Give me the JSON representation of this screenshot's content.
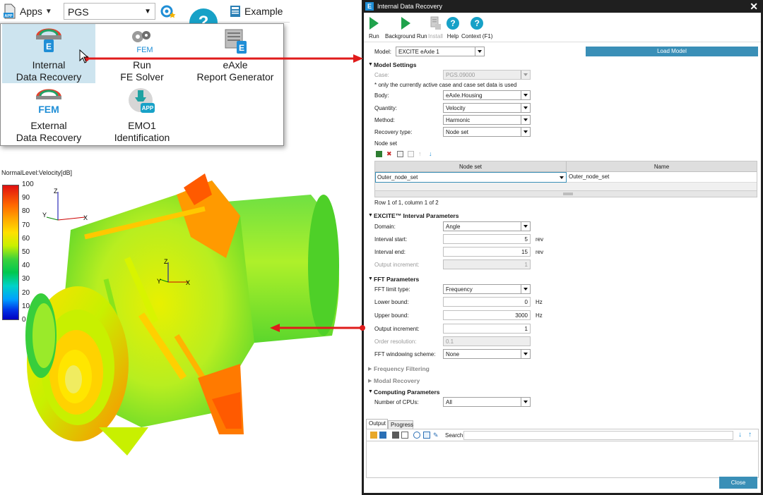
{
  "toolbar": {
    "apps_label": "Apps",
    "project_select": "PGS",
    "example_label": "Example"
  },
  "apps_menu": [
    {
      "line1": "Internal",
      "line2": "Data Recovery"
    },
    {
      "line1": "Run",
      "line2": "FE Solver"
    },
    {
      "line1": "eAxle",
      "line2": "Report Generator"
    },
    {
      "line1": "External",
      "line2": "Data Recovery"
    },
    {
      "line1": "EMO1",
      "line2": "Identification"
    }
  ],
  "icon_text": {
    "fem": "FEM",
    "app": "APP",
    "badge": "E"
  },
  "plot": {
    "legend_title": "NormalLevel:Velocity[dB]",
    "ticks": [
      "100",
      "90",
      "80",
      "70",
      "60",
      "50",
      "40",
      "30",
      "20",
      "10",
      "0"
    ],
    "axis": {
      "z": "Z",
      "y": "Y",
      "x": "X"
    }
  },
  "dialog": {
    "title": "Internal Data Recovery",
    "title_badge": "E",
    "toolbar": [
      {
        "label": "Run",
        "icon": "play-icon"
      },
      {
        "label": "Background Run",
        "icon": "play-icon"
      },
      {
        "label": "Install",
        "icon": "install-icon"
      },
      {
        "label": "Help",
        "icon": "help-icon",
        "glyph": "?"
      },
      {
        "label": "Context (F1)",
        "icon": "context-help-icon",
        "glyph": "?"
      }
    ],
    "model_label": "Model:",
    "model_value": "EXCITE eAxle 1",
    "load_model": "Load Model",
    "sections": {
      "model_settings": "Model Settings",
      "interval": "EXCITE™ Interval Parameters",
      "fft": "FFT Parameters",
      "frequency_filtering": "Frequency Filtering",
      "modal_recovery": "Modal Recovery",
      "computing": "Computing Parameters"
    },
    "model_settings": {
      "case_label": "Case:",
      "case_value": "PGS.09000",
      "note": "* only the currently active case and case set data is used",
      "body_label": "Body:",
      "body_value": "eAxle.Housing",
      "quantity_label": "Quantity:",
      "quantity_value": "Velocity",
      "method_label": "Method:",
      "method_value": "Harmonic",
      "recovery_label": "Recovery type:",
      "recovery_value": "Node set",
      "nodeset_title": "Node set",
      "grid_headers": [
        "Node set",
        "Name"
      ],
      "grid_row": [
        "Outer_node_set",
        "Outer_node_set"
      ],
      "row_info": "Row 1 of 1, column 1 of 2"
    },
    "interval": {
      "domain_label": "Domain:",
      "domain_value": "Angle",
      "start_label": "Interval start:",
      "start_value": "5",
      "start_unit": "rev",
      "end_label": "Interval end:",
      "end_value": "15",
      "end_unit": "rev",
      "inc_label": "Output increment:",
      "inc_value": "1"
    },
    "fft": {
      "limit_label": "FFT limit type:",
      "limit_value": "Frequency",
      "lower_label": "Lower bound:",
      "lower_value": "0",
      "lower_unit": "Hz",
      "upper_label": "Upper bound:",
      "upper_value": "3000",
      "upper_unit": "Hz",
      "inc_label": "Output increment:",
      "inc_value": "1",
      "order_label": "Order resolution:",
      "order_value": "0.1",
      "window_label": "FFT windowing scheme:",
      "window_value": "None"
    },
    "computing": {
      "cpus_label": "Number of CPUs:",
      "cpus_value": "All"
    },
    "output": {
      "tabs": [
        "Output",
        "Progress"
      ],
      "search_label": "Search:"
    },
    "close": "Close"
  },
  "colors": {
    "accent": "#3a8fb7",
    "run_green": "#1fa24c",
    "help_blue": "#17a1c7",
    "arrow_red": "#e01b1b"
  }
}
